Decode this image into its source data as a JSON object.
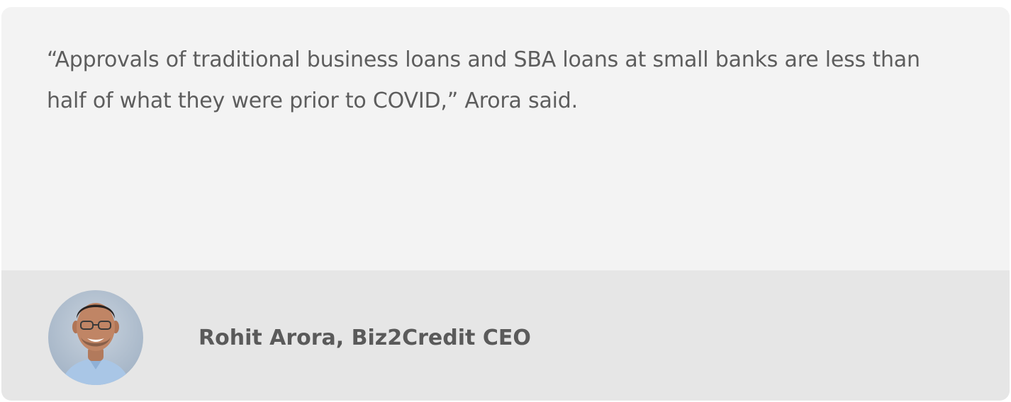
{
  "testimonial": {
    "quote": "“Approvals of traditional business loans and SBA loans at small banks are less than half of what they were prior to COVID,” Arora said.",
    "author": "Rohit Arora, Biz2Credit CEO"
  },
  "colors": {
    "quote_background": "#f3f3f3",
    "author_background": "#e6e6e6",
    "quote_text": "#5d5d5d",
    "author_text": "#5a5a5a"
  }
}
